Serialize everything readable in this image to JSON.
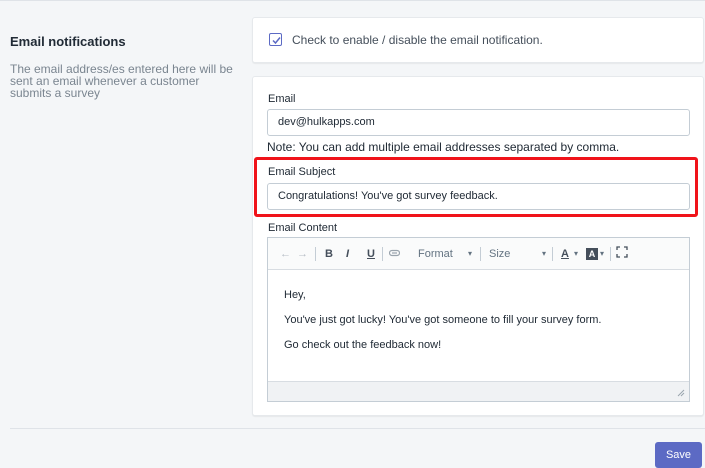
{
  "section": {
    "title": "Email notifications",
    "description": "The email address/es entered here will be sent an email whenever a customer submits a survey"
  },
  "toggle": {
    "checked": true,
    "label": "Check to enable / disable the email notification."
  },
  "email": {
    "label": "Email",
    "value": "dev@hulkapps.com",
    "note": "Note: You can add multiple email addresses separated by comma."
  },
  "subject": {
    "label": "Email Subject",
    "value": "Congratulations! You've got survey feedback."
  },
  "content": {
    "label": "Email Content",
    "toolbar": {
      "undo_icon": "undo-icon",
      "redo_icon": "redo-icon",
      "bold": "B",
      "italic": "I",
      "underline": "U",
      "link_icon": "link-icon",
      "format": "Format",
      "size": "Size",
      "text_color": "A",
      "bg_color": "A",
      "maximize_icon": "maximize-icon"
    },
    "lines": [
      "Hey,",
      "You've just got lucky! You've got someone to fill your survey form.",
      "Go check out the feedback now!"
    ]
  },
  "actions": {
    "save": "Save"
  },
  "colors": {
    "primary": "#5c6ac4",
    "highlight": "#f0131a"
  }
}
